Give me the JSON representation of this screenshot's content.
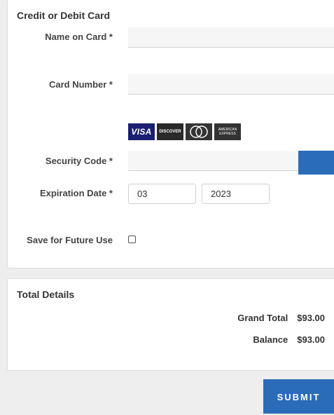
{
  "payment": {
    "title": "Credit or Debit Card",
    "name_label": "Name on Card *",
    "number_label": "Card Number *",
    "security_label": "Security Code *",
    "expiration_label": "Expiration Date *",
    "exp_month": "03",
    "exp_year": "2023",
    "save_label": "Save for Future Use",
    "save_checked": false,
    "card_logos": [
      "VISA",
      "DISCOVER",
      "MasterCard",
      "AMERICAN EXPRESS"
    ]
  },
  "totals": {
    "title": "Total Details",
    "grand_total_label": "Grand Total",
    "grand_total_value": "$93.00",
    "balance_label": "Balance",
    "balance_value": "$93.00"
  },
  "actions": {
    "submit_label": "SUBMIT"
  },
  "colors": {
    "accent": "#2b6cb8"
  }
}
